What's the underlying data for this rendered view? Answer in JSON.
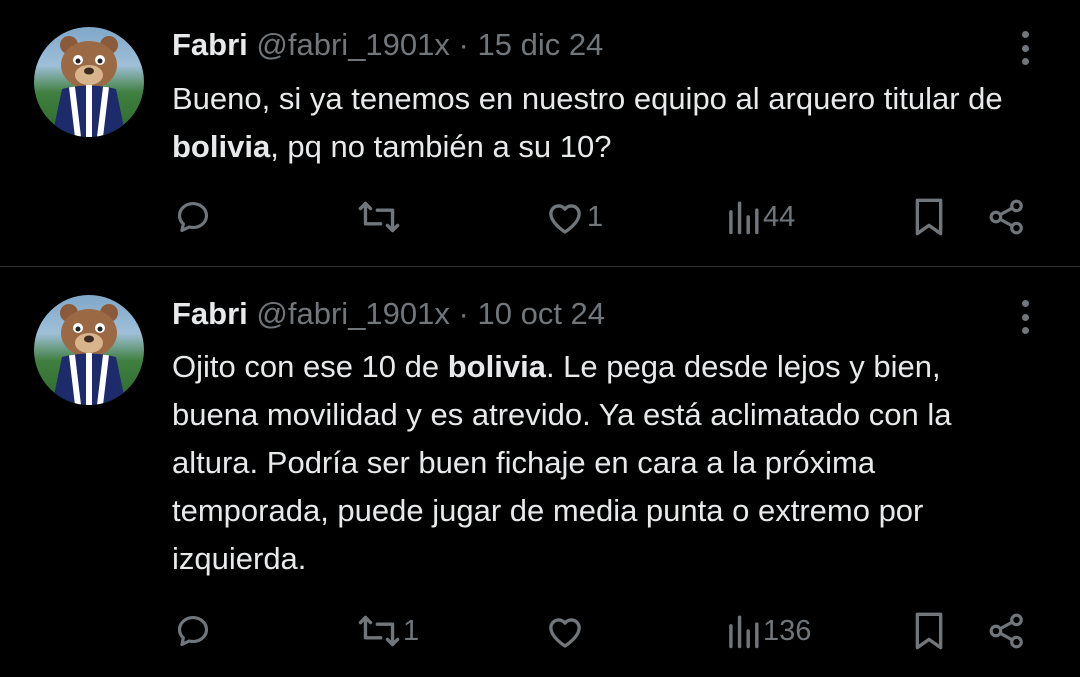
{
  "tweets": [
    {
      "name": "Fabri",
      "handle": "@fabri_1901x",
      "separator": "·",
      "date": "15 dic 24",
      "text_parts": [
        "Bueno, si ya tenemos en nuestro equipo al arquero titular de ",
        "bolivia",
        ", pq no también a su 10?"
      ],
      "replies": "",
      "retweets": "",
      "likes": "1",
      "views": "44"
    },
    {
      "name": "Fabri",
      "handle": "@fabri_1901x",
      "separator": "·",
      "date": "10 oct 24",
      "text_parts": [
        "Ojito con ese 10 de ",
        "bolivia",
        ". Le pega desde lejos y bien, buena movilidad y es atrevido. Ya está aclimatado con la altura. Podría ser buen fichaje en cara a la próxima temporada, puede jugar de media punta o extremo por izquierda."
      ],
      "replies": "",
      "retweets": "1",
      "likes": "",
      "views": "136"
    }
  ],
  "icons": [
    "more-icon",
    "reply-icon",
    "retweet-icon",
    "like-icon",
    "views-icon",
    "bookmark-icon",
    "share-icon"
  ],
  "colors": {
    "background": "#000000",
    "text": "#e7e9ea",
    "muted": "#71767b",
    "divider": "#2f3336"
  }
}
